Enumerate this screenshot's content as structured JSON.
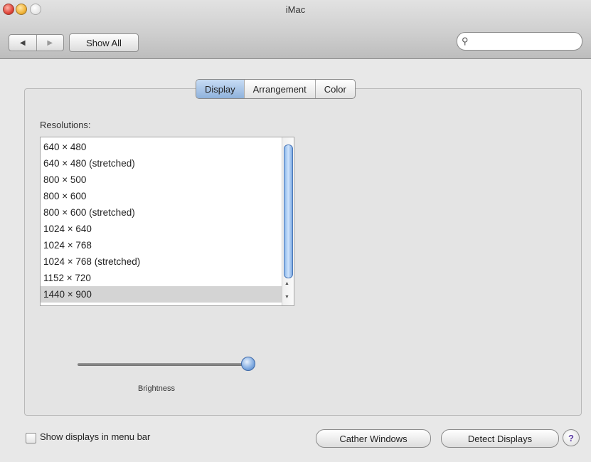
{
  "window": {
    "title": "iMac"
  },
  "toolbar": {
    "back_icon": "◀",
    "forward_icon": "▶",
    "show_all_label": "Show All",
    "search_icon": "⚲",
    "search_value": "",
    "search_placeholder": ""
  },
  "tabs": [
    {
      "label": "Display",
      "active": true
    },
    {
      "label": "Arrangement",
      "active": false
    },
    {
      "label": "Color",
      "active": false
    }
  ],
  "resolutions": {
    "label": "Resolutions:",
    "items": [
      "640 × 480",
      "640 × 480 (stretched)",
      "800 × 500",
      "800 × 600",
      "800 × 600 (stretched)",
      "1024 × 640",
      "1024 × 768",
      "1024 × 768 (stretched)",
      "1152 × 720",
      "1440 × 900"
    ],
    "selected_index": 9
  },
  "brightness": {
    "label": "Brightness",
    "level_fraction": 1.0
  },
  "footer": {
    "show_displays_label": "Show displays in menu bar",
    "show_displays_checked": false,
    "gather_label": "Cather Windows",
    "detect_label": "Detect Displays",
    "help_label": "?"
  }
}
